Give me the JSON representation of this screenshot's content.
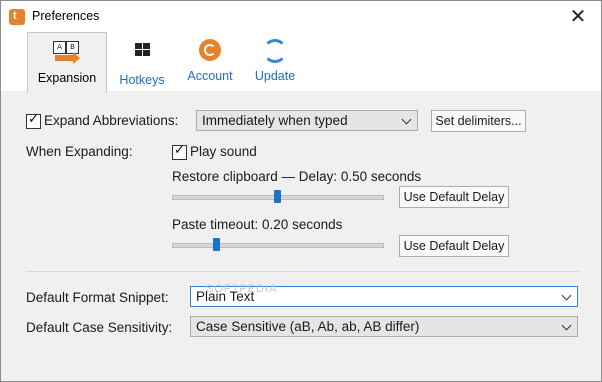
{
  "window": {
    "title": "Preferences",
    "close_glyph": "✕"
  },
  "tabs": [
    {
      "label": "Expansion",
      "icon": "ab-expand-icon",
      "active": true
    },
    {
      "label": "Hotkeys",
      "icon": "keyboard-icon"
    },
    {
      "label": "Account",
      "icon": "account-icon"
    },
    {
      "label": "Update",
      "icon": "update-icon"
    }
  ],
  "icons": {
    "box_a": "A",
    "box_b": "B"
  },
  "expansion": {
    "expand_abbrev_label": "Expand Abbreviations:",
    "expand_abbrev_checked": true,
    "expand_mode_value": "Immediately when typed",
    "set_delimiters_label": "Set delimiters...",
    "when_expanding_label": "When Expanding:",
    "play_sound_label": "Play sound",
    "play_sound_checked": true,
    "restore_label": "Restore clipboard — Delay: 0.50 seconds",
    "restore_default_btn": "Use Default Delay",
    "paste_label": "Paste timeout: 0.20 seconds",
    "paste_default_btn": "Use Default Delay",
    "default_format_label": "Default Format Snippet:",
    "default_format_value": "Plain Text",
    "case_label": "Default Case Sensitivity:",
    "case_value": "Case Sensitive (aB, Ab, ab, AB differ)"
  },
  "colors": {
    "accent": "#e8812b",
    "link": "#1e6fbf",
    "slider": "#1f6fd1"
  },
  "watermark": "SOFTPEDIA"
}
